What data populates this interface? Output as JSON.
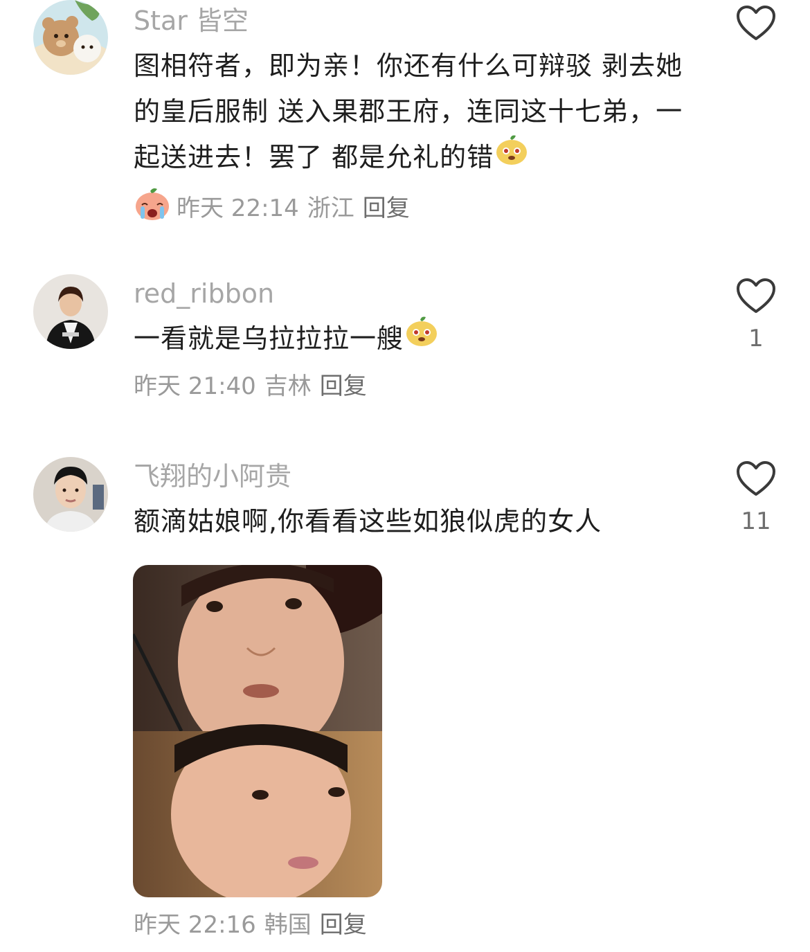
{
  "comments": [
    {
      "username": "Star 皆空",
      "text": "图相符者，即为亲！你还有什么可辩驳 剥去她的皇后服制 送入果郡王府，连同这十七弟，一起送进去！罢了 都是允礼的错",
      "time": "昨天 22:14",
      "location": "浙江",
      "reply_label": "回复",
      "like_count": "",
      "avatar_icon": "bear-cartoon-avatar",
      "trailing_emoji": "sticker-face-icon",
      "leading_meta_emoji": "crying-face-sticker-icon"
    },
    {
      "username": "red_ribbon",
      "text": "一看就是乌拉拉拉一艘",
      "time": "昨天 21:40",
      "location": "吉林",
      "reply_label": "回复",
      "like_count": "1",
      "avatar_icon": "woman-portrait-avatar",
      "trailing_emoji": "sticker-face-icon"
    },
    {
      "username": "飞翔的小阿贵",
      "text": "额滴姑娘啊,你看看这些如狼似虎的女人",
      "time": "昨天 22:16",
      "location": "韩国",
      "reply_label": "回复",
      "like_count": "11",
      "avatar_icon": "man-portrait-avatar",
      "attachment": "two-face-meme-image"
    }
  ],
  "colors": {
    "username": "#a6a6a6",
    "text": "#1e1e1e",
    "meta": "#9a9a9a",
    "heart_stroke": "#3a3a3a"
  }
}
